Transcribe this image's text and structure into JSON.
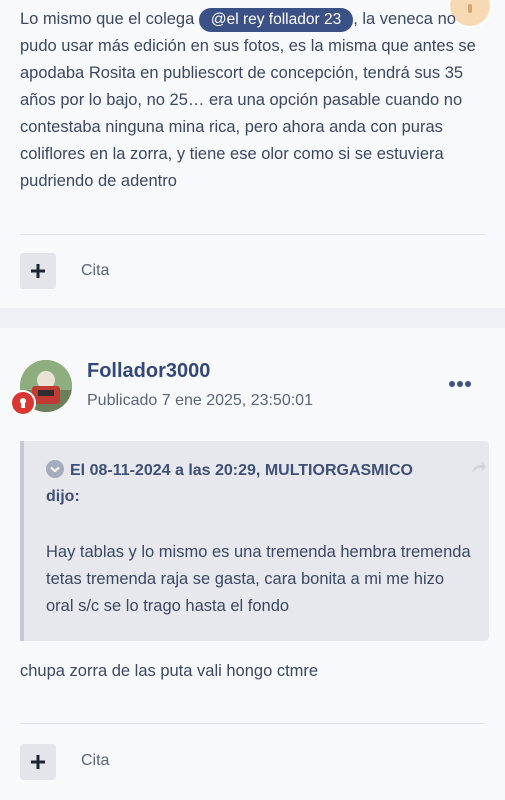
{
  "post1": {
    "text_before": "Lo mismo que el colega ",
    "mention": "@el rey follador 23",
    "text_after": ", la veneca no pudo usar más edición en sus fotos, es la misma que antes se apodaba Rosita en publiescort de concepción, tendrá sus 35 años por lo bajo, no 25… era una opción pasable cuando no contestaba ninguna mina rica, pero ahora anda con puras coliflores en la zorra, y tiene ese olor como si se estuviera pudriendo de adentro",
    "quote_button_label": "Cita"
  },
  "post2": {
    "author": "Follador3000",
    "date": "Publicado 7 ene 2025, 23:50:01",
    "quote": {
      "header": "El 08-11-2024 a las 20:29, MULTIORGASMICO dijo:",
      "body": "Hay tablas y lo mismo es una tremenda hembra tremenda tetas tremenda raja se gasta, cara bonita a mi me hizo oral s/c se lo trago hasta el fondo"
    },
    "text": "chupa zorra de las puta vali hongo ctmre",
    "quote_button_label": "Cita"
  },
  "colors": {
    "mention_bg": "#3b5186",
    "author": "#344779",
    "badge": "#d9372f",
    "fab": "#f7d9b3"
  },
  "icons": {
    "add": "plus-icon",
    "more": "ellipsis-icon",
    "quote_expand": "chevron-down-circle-icon",
    "quote_share": "share-arrow-icon",
    "fab": "exclamation-icon",
    "badge": "award-icon"
  }
}
